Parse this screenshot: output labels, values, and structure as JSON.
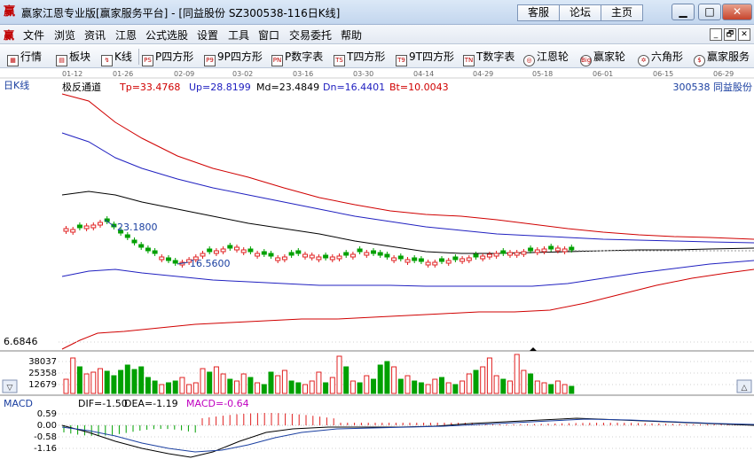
{
  "window": {
    "app_icon": "赢",
    "title": "赢家江恩专业版[赢家服务平台] - [同益股份  SZ300538-116日K线]",
    "buttons": [
      "客服",
      "论坛",
      "主页"
    ],
    "min": "▁",
    "max": "□",
    "close": "✕"
  },
  "menu": {
    "items": [
      "文件",
      "浏览",
      "资讯",
      "江恩",
      "公式选股",
      "设置",
      "工具",
      "窗口",
      "交易委托",
      "帮助"
    ],
    "mdi": [
      "_",
      "🗗",
      "✕"
    ]
  },
  "toolbar": {
    "items": [
      {
        "icon": "grid-icon",
        "glyph": "▦",
        "label": "行情"
      },
      {
        "icon": "panel-icon",
        "glyph": "▤",
        "label": "板块"
      },
      {
        "icon": "candle-icon",
        "glyph": "↯",
        "label": "K线"
      },
      {
        "icon": "ps-icon",
        "glyph": "PS",
        "label": "P四方形"
      },
      {
        "icon": "p9-icon",
        "glyph": "P9",
        "label": "9P四方形"
      },
      {
        "icon": "pn-icon",
        "glyph": "PN",
        "label": "P数字表"
      },
      {
        "icon": "ts-icon",
        "glyph": "TS",
        "label": "T四方形"
      },
      {
        "icon": "t9-icon",
        "glyph": "T9",
        "label": "9T四方形"
      },
      {
        "icon": "tn-icon",
        "glyph": "TN",
        "label": "T数字表"
      },
      {
        "icon": "wheel-icon",
        "glyph": "◎",
        "label": "江恩轮"
      },
      {
        "icon": "big-icon",
        "glyph": "Big",
        "label": "赢家轮"
      },
      {
        "icon": "hexagon-icon",
        "glyph": "✡",
        "label": "六角形"
      },
      {
        "icon": "dollar-icon",
        "glyph": "$",
        "label": "赢家服务"
      }
    ]
  },
  "chart": {
    "period_label": "日K线",
    "dates": [
      "01-12",
      "01-26",
      "02-09",
      "03-02",
      "03-16",
      "03-30",
      "04-14",
      "04-29",
      "05-18",
      "06-01",
      "06-15",
      "06-29"
    ],
    "indicator": {
      "name": "极反通道",
      "tp": "Tp=33.4768",
      "up": "Up=28.8199",
      "md": "Md=23.4849",
      "dn": "Dn=16.4401",
      "bt": "Bt=10.0043"
    },
    "stock": "300538   同益股份",
    "high_label": "23.1800",
    "low_label": "16.5600",
    "price_axis_label": "6.6846",
    "volume_ticks": [
      "38037",
      "25358",
      "12679"
    ],
    "macd": {
      "name": "MACD",
      "dif": "DIF=-1.50",
      "dea": "DEA=-1.19",
      "macd": "MACD=-0.64",
      "ticks": [
        "0.59",
        "0.00",
        "-0.58",
        "-1.16"
      ]
    },
    "colors": {
      "up": "#e02020",
      "down": "#00a000",
      "tp": "#d00000",
      "up_line": "#2020c0",
      "md": "#000000",
      "dn": "#2020c0",
      "bt": "#d00000",
      "label": "#1a3fa0"
    }
  }
}
